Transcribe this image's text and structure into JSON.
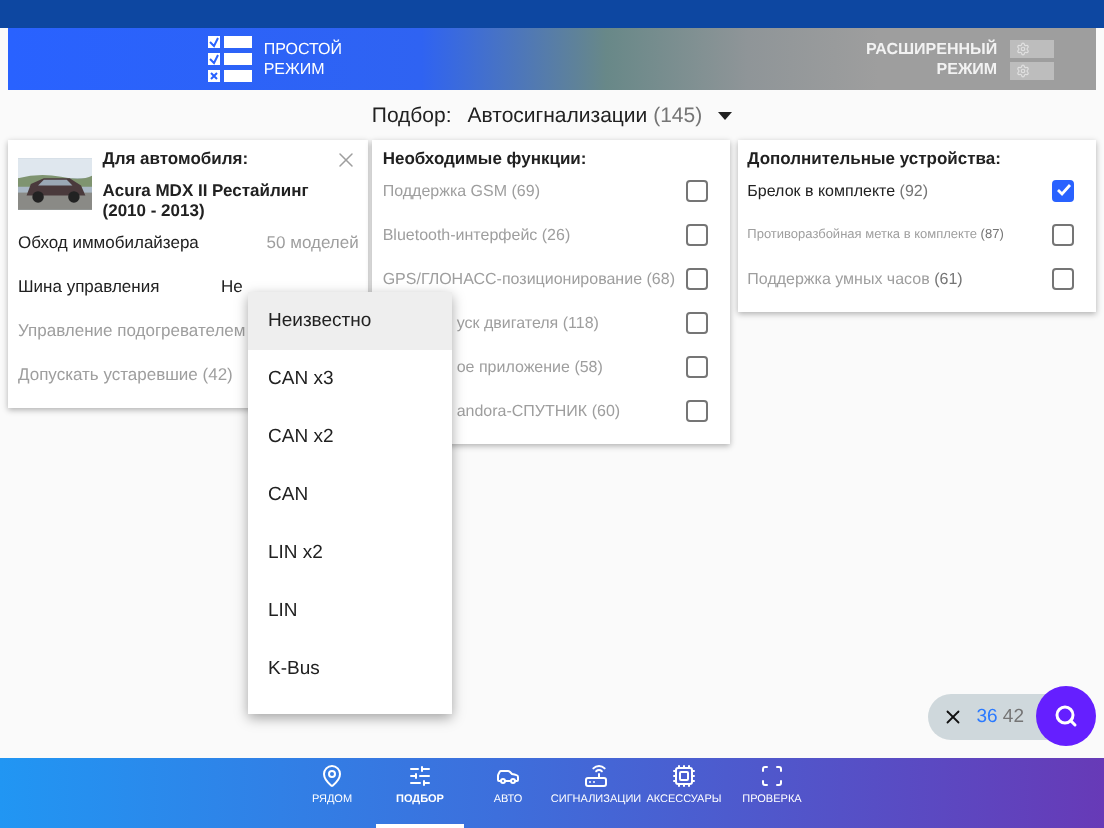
{
  "mode_switch": [
    {
      "lines": [
        "ПРОСТОЙ",
        "РЕЖИМ"
      ],
      "selected": true
    },
    {
      "lines": [
        "РАСШИРЕННЫЙ",
        "РЕЖИМ"
      ],
      "selected": false
    }
  ],
  "selection": {
    "label": "Подбор:",
    "value": "Автосигнализации",
    "count": "(145)"
  },
  "car_card": {
    "title": "Для автомобиля:",
    "car": "Acura MDX II Рестайлинг (2010 - 2013)",
    "rows": [
      {
        "label": "Обход иммобилайзера",
        "value": "50 моделей",
        "disabled": false
      },
      {
        "label": "Шина управления",
        "value": "Не",
        "disabled": false
      },
      {
        "label": "Управление подогревателем",
        "disabled": true
      },
      {
        "label": "Допускать устаревшие (42)",
        "disabled": true
      }
    ]
  },
  "functions": {
    "title": "Необходимые функции:",
    "items": [
      {
        "label": "Поддержка GSM",
        "count": "(69)",
        "checked": false,
        "covered": false
      },
      {
        "label": "Bluetooth-интерфейс",
        "count": "(26)",
        "checked": false,
        "covered": false
      },
      {
        "label": "GPS/ГЛОНАСС-позиционирование",
        "count": "(68)",
        "checked": false,
        "covered": false
      },
      {
        "label": "уск двигателя",
        "count": "(118)",
        "checked": false,
        "covered": true
      },
      {
        "label": "ое приложение",
        "count": "(58)",
        "checked": false,
        "covered": true
      },
      {
        "label": "andora-СПУТНИК",
        "count": "(60)",
        "checked": false,
        "covered": true
      }
    ]
  },
  "devices": {
    "title": "Дополнительные устройства:",
    "items": [
      {
        "label": "Брелок в комплекте",
        "count": "(92)",
        "checked": true,
        "disabled": false,
        "kind": "normal"
      },
      {
        "label": "Противоразбойная метка в комплекте",
        "count": "(87)",
        "checked": false,
        "disabled": true,
        "kind": "compact"
      },
      {
        "label": "Поддержка умных часов",
        "count": "(61)",
        "checked": false,
        "disabled": true,
        "kind": "normal"
      }
    ]
  },
  "dropdown": {
    "options": [
      {
        "label": "Неизвестно",
        "selected": true
      },
      {
        "label": "CAN x3",
        "selected": false
      },
      {
        "label": "CAN x2",
        "selected": false
      },
      {
        "label": "CAN",
        "selected": false
      },
      {
        "label": "LIN x2",
        "selected": false
      },
      {
        "label": "LIN",
        "selected": false
      },
      {
        "label": "K-Bus",
        "selected": false
      }
    ]
  },
  "result_counter": {
    "matched": "36",
    "total": "42"
  },
  "bottom_nav": [
    {
      "label": "РЯДОМ",
      "selected": false
    },
    {
      "label": "ПОДБОР",
      "selected": true
    },
    {
      "label": "АВТО",
      "selected": false
    },
    {
      "label": "СИГНАЛИЗАЦИИ",
      "selected": false
    },
    {
      "label": "АКСЕССУАРЫ",
      "selected": false
    },
    {
      "label": "ПРОВЕРКА",
      "selected": false
    }
  ]
}
